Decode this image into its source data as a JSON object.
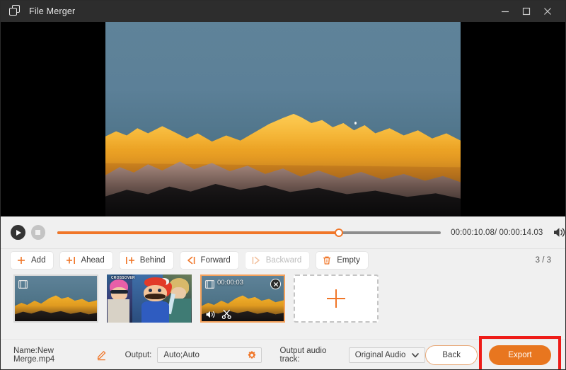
{
  "window": {
    "title": "File Merger",
    "logo_icon": "file-merger-logo-icon",
    "minimize_icon": "minimize-icon",
    "maximize_icon": "maximize-icon",
    "close_icon": "close-icon"
  },
  "preview": {
    "content_description": "Golden sunlit snowy mountain range at sunrise against a teal-blue sky",
    "letterbox_color": "#000000"
  },
  "player": {
    "play_icon": "play-icon",
    "stop_icon": "stop-icon",
    "progress_percent": 73.5,
    "current_time": "00:00:10.08",
    "total_time": "00:00:14.03",
    "time_display": "00:00:10.08/ 00:00:14.03",
    "volume_icon": "volume-on-icon",
    "accent_color": "#f07628"
  },
  "toolbar": {
    "buttons": [
      {
        "label": "Add",
        "icon": "plus-icon",
        "disabled": false
      },
      {
        "label": "Ahead",
        "icon": "plus-before-icon",
        "disabled": false
      },
      {
        "label": "Behind",
        "icon": "plus-after-icon",
        "disabled": false
      },
      {
        "label": "Forward",
        "icon": "move-forward-icon",
        "disabled": false
      },
      {
        "label": "Backward",
        "icon": "move-backward-icon",
        "disabled": true
      },
      {
        "label": "Empty",
        "icon": "trash-icon",
        "disabled": false
      }
    ],
    "counter": "3 / 3"
  },
  "clips": [
    {
      "index": 1,
      "kind": "mountain",
      "selected": false,
      "film_icon": "film-strip-icon"
    },
    {
      "index": 2,
      "kind": "game",
      "selected": false,
      "poster_text": "CROSSOVER"
    },
    {
      "index": 3,
      "kind": "mountain",
      "selected": true,
      "duration": "00:00:03",
      "film_icon": "film-strip-icon",
      "close_icon": "close-icon",
      "mute_icon": "volume-mute-icon",
      "cut_icon": "scissors-icon"
    }
  ],
  "add_clip": {
    "icon": "plus-icon",
    "label": ""
  },
  "footer": {
    "name_label": "Name:New Merge.mp4",
    "edit_icon": "pencil-icon",
    "output_label": "Output:",
    "output_value": "Auto;Auto",
    "output_settings_icon": "gear-icon",
    "audio_track_label": "Output audio track:",
    "audio_track_value": "Original Audio",
    "audio_track_caret_icon": "chevron-down-icon",
    "back_label": "Back",
    "export_label": "Export",
    "highlight_color": "#ee1c18"
  }
}
